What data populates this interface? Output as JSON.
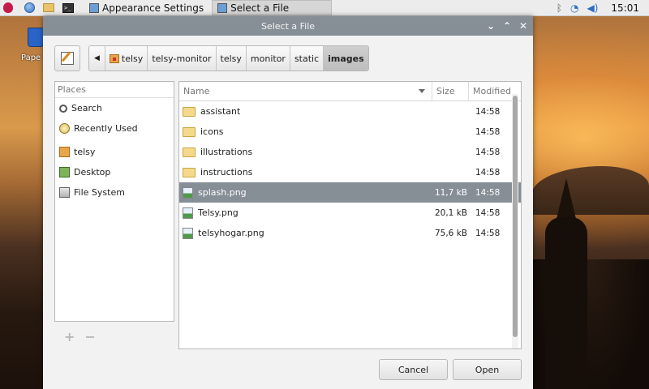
{
  "desktop": {
    "icon_label": "Pape"
  },
  "taskbar": {
    "tasks": [
      {
        "label": "Appearance Settings"
      },
      {
        "label": "Select a File"
      }
    ],
    "clock": "15:01",
    "icons": [
      "raspberry-menu-icon",
      "browser-globe-icon",
      "file-manager-icon",
      "terminal-icon",
      "bluetooth-icon",
      "wifi-icon",
      "volume-icon"
    ]
  },
  "dialog": {
    "title": "Select a File",
    "breadcrumbs": [
      "telsy",
      "telsy-monitor",
      "telsy",
      "monitor",
      "static",
      "images"
    ],
    "places": {
      "header": "Places",
      "items": [
        {
          "label": "Search",
          "icon": "search-icon"
        },
        {
          "label": "Recently Used",
          "icon": "recent-icon"
        },
        {
          "label": "telsy",
          "icon": "home-folder-icon"
        },
        {
          "label": "Desktop",
          "icon": "desktop-icon"
        },
        {
          "label": "File System",
          "icon": "drive-icon"
        }
      ],
      "add_symbol": "+",
      "remove_symbol": "−"
    },
    "files": {
      "columns": [
        "Name",
        "Size",
        "Modified"
      ],
      "rows": [
        {
          "name": "assistant",
          "size": "",
          "modified": "14:58",
          "type": "folder"
        },
        {
          "name": "icons",
          "size": "",
          "modified": "14:58",
          "type": "folder"
        },
        {
          "name": "illustrations",
          "size": "",
          "modified": "14:58",
          "type": "folder"
        },
        {
          "name": "instructions",
          "size": "",
          "modified": "14:58",
          "type": "folder"
        },
        {
          "name": "splash.png",
          "size": "11,7 kB",
          "modified": "14:58",
          "type": "image",
          "selected": true
        },
        {
          "name": "Telsy.png",
          "size": "20,1 kB",
          "modified": "14:58",
          "type": "image"
        },
        {
          "name": "telsyhogar.png",
          "size": "75,6 kB",
          "modified": "14:58",
          "type": "image"
        }
      ]
    },
    "buttons": {
      "cancel": "Cancel",
      "open": "Open"
    }
  },
  "colors": {
    "titlebar": "#868e96",
    "selection": "#868e96",
    "dialog_bg": "#f2f2f2"
  }
}
